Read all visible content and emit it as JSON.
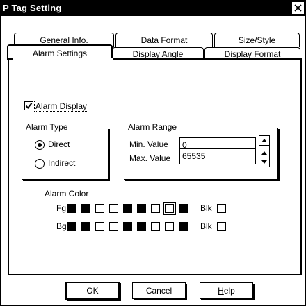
{
  "window": {
    "title": "P Tag Setting"
  },
  "tabs": {
    "general_info": "General Info.",
    "data_format": "Data Format",
    "size_style": "Size/Style",
    "alarm_settings": "Alarm Settings",
    "display_angle": "Display Angle",
    "display_format": "Display Format"
  },
  "alarm_display": {
    "label": "Alarm Display",
    "checked": true
  },
  "alarm_type": {
    "title": "Alarm Type",
    "options": [
      "Direct",
      "Indirect"
    ],
    "selected": "Direct"
  },
  "alarm_range": {
    "title": "Alarm Range",
    "min_label": "Min. Value",
    "min_value": "0",
    "max_label": "Max. Value",
    "max_value": "65535"
  },
  "alarm_color": {
    "title": "Alarm Color",
    "fg_label": "Fg",
    "bg_label": "Bg",
    "blk_label": "Blk",
    "fg_swatches": [
      "dark",
      "dark",
      "light",
      "light",
      "dark",
      "dark",
      "light",
      "light-selected",
      "dark"
    ],
    "bg_swatches": [
      "dark",
      "dark",
      "light",
      "light",
      "dark",
      "dark",
      "light",
      "light",
      "dark"
    ]
  },
  "buttons": {
    "ok": "OK",
    "cancel": "Cancel",
    "help_h": "H",
    "help_rest": "elp"
  }
}
